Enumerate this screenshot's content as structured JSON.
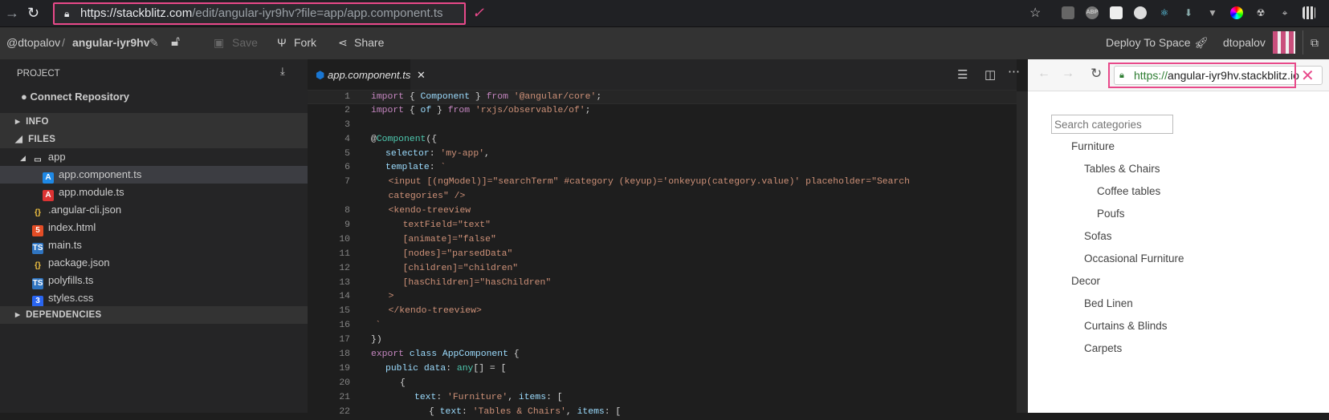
{
  "browser": {
    "url_scheme": "https://",
    "url_host": "stackblitz.com",
    "url_path": "/edit/angular-iyr9hv?file=app/app.component.ts",
    "annotation_check": "✓",
    "extensions": [
      "ABP"
    ]
  },
  "header": {
    "user": "@dtopalov",
    "separator": "/",
    "project": "angular-iyr9hv",
    "save": "Save",
    "fork": "Fork",
    "share": "Share",
    "deploy": "Deploy To Space",
    "username": "dtopalov"
  },
  "sidebar": {
    "project_label": "PROJECT",
    "connect_repo": "Connect Repository",
    "info": "INFO",
    "files": "FILES",
    "dependencies": "DEPENDENCIES",
    "tree": [
      {
        "name": "app",
        "type": "folder",
        "depth": 0
      },
      {
        "name": "app.component.ts",
        "type": "angular-blue",
        "depth": 1,
        "selected": true
      },
      {
        "name": "app.module.ts",
        "type": "angular-red",
        "depth": 1
      },
      {
        "name": ".angular-cli.json",
        "type": "json",
        "depth": 0
      },
      {
        "name": "index.html",
        "type": "html",
        "depth": 0
      },
      {
        "name": "main.ts",
        "type": "ts",
        "depth": 0
      },
      {
        "name": "package.json",
        "type": "json",
        "depth": 0
      },
      {
        "name": "polyfills.ts",
        "type": "ts",
        "depth": 0
      },
      {
        "name": "styles.css",
        "type": "css",
        "depth": 0
      }
    ]
  },
  "editor": {
    "tab": "app.component.ts",
    "lines": [
      {
        "n": "1",
        "i": 0,
        "t": [
          [
            "kw",
            "import"
          ],
          [
            "pl",
            " { "
          ],
          [
            "prop",
            "Component"
          ],
          [
            "pl",
            " } "
          ],
          [
            "kw",
            "from"
          ],
          [
            "pl",
            " "
          ],
          [
            "str",
            "'@angular/core'"
          ],
          [
            "pl",
            ";"
          ]
        ]
      },
      {
        "n": "2",
        "i": 0,
        "t": [
          [
            "kw",
            "import"
          ],
          [
            "pl",
            " { "
          ],
          [
            "fn",
            "of"
          ],
          [
            "pl",
            " } "
          ],
          [
            "kw",
            "from"
          ],
          [
            "pl",
            " "
          ],
          [
            "str",
            "'rxjs/observable/of'"
          ],
          [
            "pl",
            ";"
          ]
        ]
      },
      {
        "n": "3",
        "i": 0,
        "t": []
      },
      {
        "n": "4",
        "i": 0,
        "t": [
          [
            "pl",
            "@"
          ],
          [
            "type",
            "Component"
          ],
          [
            "pl",
            "({"
          ]
        ]
      },
      {
        "n": "5",
        "i": 1,
        "t": [
          [
            "prop",
            "selector"
          ],
          [
            "pl",
            ": "
          ],
          [
            "str",
            "'my-app'"
          ],
          [
            "pl",
            ","
          ]
        ]
      },
      {
        "n": "6",
        "i": 1,
        "t": [
          [
            "prop",
            "template"
          ],
          [
            "pl",
            ": "
          ],
          [
            "str",
            "`"
          ]
        ]
      },
      {
        "n": "7",
        "i": 1.2,
        "t": [
          [
            "str",
            "<input [(ngModel)]=\"searchTerm\" #category (keyup)='onkeyup(category.value)' placeholder=\"Search"
          ]
        ]
      },
      {
        "n": "",
        "i": 1.2,
        "t": [
          [
            "str",
            "categories\" />"
          ]
        ]
      },
      {
        "n": "8",
        "i": 1.2,
        "t": [
          [
            "str",
            "<kendo-treeview"
          ]
        ]
      },
      {
        "n": "9",
        "i": 2.2,
        "t": [
          [
            "str",
            "textField=\"text\""
          ]
        ]
      },
      {
        "n": "10",
        "i": 2.2,
        "t": [
          [
            "str",
            "[animate]=\"false\""
          ]
        ]
      },
      {
        "n": "11",
        "i": 2.2,
        "t": [
          [
            "str",
            "[nodes]=\"parsedData\""
          ]
        ]
      },
      {
        "n": "12",
        "i": 2.2,
        "t": [
          [
            "str",
            "[children]=\"children\""
          ]
        ]
      },
      {
        "n": "13",
        "i": 2.2,
        "t": [
          [
            "str",
            "[hasChildren]=\"hasChildren\""
          ]
        ]
      },
      {
        "n": "14",
        "i": 1.2,
        "t": [
          [
            "str",
            ">"
          ]
        ]
      },
      {
        "n": "15",
        "i": 1.2,
        "t": [
          [
            "str",
            "</kendo-treeview>"
          ]
        ]
      },
      {
        "n": "16",
        "i": 0.3,
        "t": [
          [
            "str",
            "`"
          ]
        ]
      },
      {
        "n": "17",
        "i": 0,
        "t": [
          [
            "pl",
            "})"
          ]
        ]
      },
      {
        "n": "18",
        "i": 0,
        "t": [
          [
            "kw",
            "export"
          ],
          [
            "pl",
            " "
          ],
          [
            "prop",
            "class"
          ],
          [
            "pl",
            " "
          ],
          [
            "fn",
            "AppComponent"
          ],
          [
            "pl",
            " {"
          ]
        ]
      },
      {
        "n": "19",
        "i": 1,
        "t": [
          [
            "prop",
            "public"
          ],
          [
            "pl",
            " "
          ],
          [
            "fn",
            "data"
          ],
          [
            "pl",
            ": "
          ],
          [
            "type",
            "any"
          ],
          [
            "pl",
            "[] = ["
          ]
        ]
      },
      {
        "n": "20",
        "i": 2,
        "t": [
          [
            "pl",
            "{"
          ]
        ]
      },
      {
        "n": "21",
        "i": 3,
        "t": [
          [
            "prop",
            "text"
          ],
          [
            "pl",
            ": "
          ],
          [
            "str",
            "'Furniture'"
          ],
          [
            "pl",
            ", "
          ],
          [
            "prop",
            "items"
          ],
          [
            "pl",
            ": ["
          ]
        ]
      },
      {
        "n": "22",
        "i": 4,
        "t": [
          [
            "pl",
            "{ "
          ],
          [
            "prop",
            "text"
          ],
          [
            "pl",
            ": "
          ],
          [
            "str",
            "'Tables & Chairs'"
          ],
          [
            "pl",
            ", "
          ],
          [
            "prop",
            "items"
          ],
          [
            "pl",
            ": ["
          ]
        ]
      }
    ]
  },
  "preview": {
    "url_scheme": "https://",
    "url_host": "angular-iyr9hv.stackblitz.io",
    "annotation_x": "✕",
    "search_placeholder": "Search categories",
    "tree": [
      {
        "text": "Furniture",
        "level": 0
      },
      {
        "text": "Tables & Chairs",
        "level": 1
      },
      {
        "text": "Coffee tables",
        "level": 2
      },
      {
        "text": "Poufs",
        "level": 2
      },
      {
        "text": "Sofas",
        "level": 1
      },
      {
        "text": "Occasional Furniture",
        "level": 1
      },
      {
        "text": "Decor",
        "level": 0
      },
      {
        "text": "Bed Linen",
        "level": 1
      },
      {
        "text": "Curtains & Blinds",
        "level": 1
      },
      {
        "text": "Carpets",
        "level": 1
      }
    ]
  },
  "colors": {
    "annotation": "#e8498a",
    "keyword": "#c586c0",
    "string": "#ce9178",
    "identifier": "#9cdcfe",
    "type": "#4ec9b0"
  }
}
